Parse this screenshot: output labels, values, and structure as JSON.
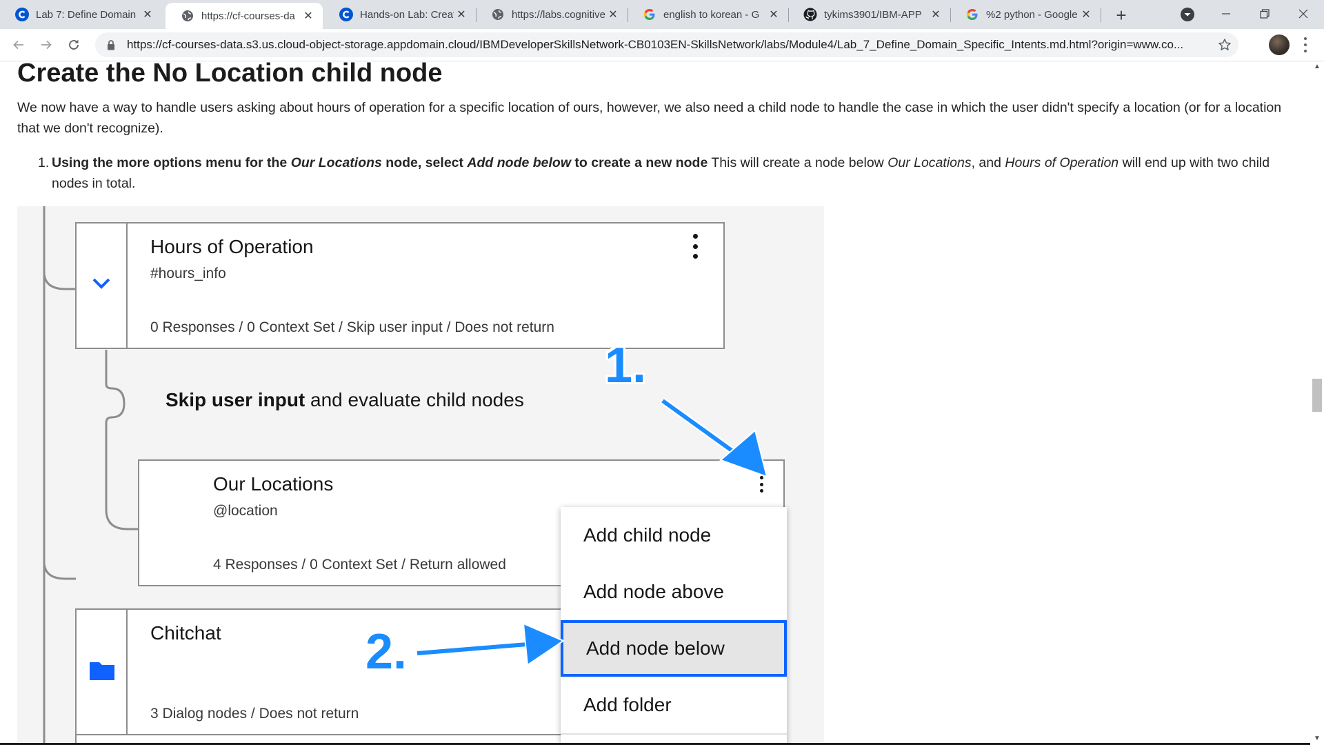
{
  "browser": {
    "tabs": [
      {
        "title": "Lab 7: Define Domain",
        "icon": "coursera-c-icon",
        "active": false
      },
      {
        "title": "https://cf-courses-da",
        "icon": "globe-icon",
        "active": true
      },
      {
        "title": "Hands-on Lab: Creati",
        "icon": "coursera-c-icon",
        "active": false
      },
      {
        "title": "https://labs.cognitive",
        "icon": "globe-icon",
        "active": false
      },
      {
        "title": "english to korean - G",
        "icon": "google-g-icon",
        "active": false
      },
      {
        "title": "tykims3901/IBM-APP",
        "icon": "github-icon",
        "active": false
      },
      {
        "title": "%2 python - Google",
        "icon": "google-g-icon",
        "active": false
      }
    ],
    "url": "https://cf-courses-data.s3.us.cloud-object-storage.appdomain.cloud/IBMDeveloperSkillsNetwork-CB0103EN-SkillsNetwork/labs/Module4/Lab_7_Define_Domain_Specific_Intents.md.html?origin=www.co..."
  },
  "page": {
    "heading": "Create the No Location child node",
    "paragraph": "We now have a way to handle users asking about hours of operation for a specific location of ours, however, we also need a child node to handle the case in which the user didn't specify a location (or for a location that we don't recognize).",
    "step": {
      "number": "1.",
      "b1": "Using the more options menu for the ",
      "b2": "Our Locations",
      "b3": " node, select ",
      "b4": "Add node below",
      "b5": " to create a new node",
      "t1": " This will create a node below ",
      "t2": "Our Locations",
      "t3": ", and ",
      "t4": "Hours of Operation",
      "t5": " will end up with two child nodes in total."
    }
  },
  "figure": {
    "hours_node": {
      "title": "Hours of Operation",
      "intent": "#hours_info",
      "meta": "0 Responses / 0 Context Set / Skip user input / Does not return"
    },
    "skip": {
      "bold": "Skip user input",
      "rest": " and evaluate child nodes"
    },
    "locations_node": {
      "title": "Our Locations",
      "entity": "@location",
      "meta": "4 Responses / 0 Context Set / Return allowed"
    },
    "chitchat_node": {
      "title": "Chitchat",
      "meta": "3 Dialog nodes / Does not return"
    },
    "menu_items": [
      "Add child node",
      "Add node above",
      "Add node below",
      "Add folder"
    ],
    "callouts": [
      "1.",
      "2."
    ],
    "accent_color": "#0f62fe",
    "arrow_color": "#1a8cff"
  }
}
